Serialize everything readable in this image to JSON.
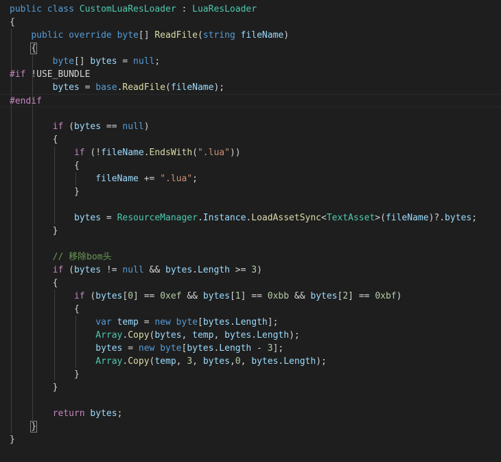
{
  "editor": {
    "language": "csharp",
    "colors": {
      "background": "#1e1e1e",
      "keyword": "#569cd6",
      "control": "#c586c0",
      "type": "#4ec9b0",
      "function": "#dcdcaa",
      "identifier": "#9cdcfe",
      "string": "#ce9178",
      "number": "#b5cea8",
      "comment": "#6a9955",
      "text": "#d4d4d4"
    },
    "lines": [
      {
        "indent": 0,
        "tokens": [
          [
            "kw",
            "public"
          ],
          [
            "punct",
            " "
          ],
          [
            "kw",
            "class"
          ],
          [
            "punct",
            " "
          ],
          [
            "type",
            "CustomLuaResLoader"
          ],
          [
            "punct",
            " : "
          ],
          [
            "type",
            "LuaResLoader"
          ]
        ]
      },
      {
        "indent": 0,
        "tokens": [
          [
            "punct",
            "{"
          ]
        ]
      },
      {
        "indent": 1,
        "tokens": [
          [
            "kw",
            "public"
          ],
          [
            "punct",
            " "
          ],
          [
            "kw",
            "override"
          ],
          [
            "punct",
            " "
          ],
          [
            "kw",
            "byte"
          ],
          [
            "punct",
            "[] "
          ],
          [
            "fn",
            "ReadFile"
          ],
          [
            "punct",
            "("
          ],
          [
            "kw",
            "string"
          ],
          [
            "punct",
            " "
          ],
          [
            "id",
            "fileName"
          ],
          [
            "punct",
            ")"
          ]
        ]
      },
      {
        "indent": 1,
        "tokens": [
          [
            "bracket",
            "{"
          ]
        ]
      },
      {
        "indent": 2,
        "tokens": [
          [
            "kw",
            "byte"
          ],
          [
            "punct",
            "[] "
          ],
          [
            "id",
            "bytes"
          ],
          [
            "punct",
            " = "
          ],
          [
            "kw",
            "null"
          ],
          [
            "punct",
            ";"
          ]
        ]
      },
      {
        "indent": 0,
        "tokens": [
          [
            "pre",
            "#if"
          ],
          [
            "pre-name",
            " !USE_BUNDLE"
          ]
        ]
      },
      {
        "indent": 2,
        "tokens": [
          [
            "id",
            "bytes"
          ],
          [
            "punct",
            " = "
          ],
          [
            "kw",
            "base"
          ],
          [
            "punct",
            "."
          ],
          [
            "fn",
            "ReadFile"
          ],
          [
            "punct",
            "("
          ],
          [
            "id",
            "fileName"
          ],
          [
            "punct",
            ");"
          ]
        ]
      },
      {
        "indent": 0,
        "current": true,
        "tokens": [
          [
            "pre",
            "#endif"
          ]
        ]
      },
      {
        "indent": 0,
        "tokens": []
      },
      {
        "indent": 2,
        "tokens": [
          [
            "ctl",
            "if"
          ],
          [
            "punct",
            " ("
          ],
          [
            "id",
            "bytes"
          ],
          [
            "punct",
            " == "
          ],
          [
            "kw",
            "null"
          ],
          [
            "punct",
            ")"
          ]
        ]
      },
      {
        "indent": 2,
        "tokens": [
          [
            "punct",
            "{"
          ]
        ]
      },
      {
        "indent": 3,
        "tokens": [
          [
            "ctl",
            "if"
          ],
          [
            "punct",
            " (!"
          ],
          [
            "id",
            "fileName"
          ],
          [
            "punct",
            "."
          ],
          [
            "fn",
            "EndsWith"
          ],
          [
            "punct",
            "("
          ],
          [
            "str",
            "\".lua\""
          ],
          [
            "punct",
            "))"
          ]
        ]
      },
      {
        "indent": 3,
        "tokens": [
          [
            "punct",
            "{"
          ]
        ]
      },
      {
        "indent": 4,
        "tokens": [
          [
            "id",
            "fileName"
          ],
          [
            "punct",
            " += "
          ],
          [
            "str",
            "\".lua\""
          ],
          [
            "punct",
            ";"
          ]
        ]
      },
      {
        "indent": 3,
        "tokens": [
          [
            "punct",
            "}"
          ]
        ]
      },
      {
        "indent": 0,
        "tokens": []
      },
      {
        "indent": 3,
        "tokens": [
          [
            "id",
            "bytes"
          ],
          [
            "punct",
            " = "
          ],
          [
            "type",
            "ResourceManager"
          ],
          [
            "punct",
            "."
          ],
          [
            "id",
            "Instance"
          ],
          [
            "punct",
            "."
          ],
          [
            "fn",
            "LoadAssetSync"
          ],
          [
            "punct",
            "<"
          ],
          [
            "type",
            "TextAsset"
          ],
          [
            "punct",
            ">("
          ],
          [
            "id",
            "fileName"
          ],
          [
            "punct",
            ")?."
          ],
          [
            "id",
            "bytes"
          ],
          [
            "punct",
            ";"
          ]
        ]
      },
      {
        "indent": 2,
        "tokens": [
          [
            "punct",
            "}"
          ]
        ]
      },
      {
        "indent": 0,
        "tokens": []
      },
      {
        "indent": 2,
        "tokens": [
          [
            "cmt",
            "// 移除bom头"
          ]
        ]
      },
      {
        "indent": 2,
        "tokens": [
          [
            "ctl",
            "if"
          ],
          [
            "punct",
            " ("
          ],
          [
            "id",
            "bytes"
          ],
          [
            "punct",
            " != "
          ],
          [
            "kw",
            "null"
          ],
          [
            "punct",
            " && "
          ],
          [
            "id",
            "bytes"
          ],
          [
            "punct",
            "."
          ],
          [
            "id",
            "Length"
          ],
          [
            "punct",
            " >= "
          ],
          [
            "num",
            "3"
          ],
          [
            "punct",
            ")"
          ]
        ]
      },
      {
        "indent": 2,
        "tokens": [
          [
            "punct",
            "{"
          ]
        ]
      },
      {
        "indent": 3,
        "tokens": [
          [
            "ctl",
            "if"
          ],
          [
            "punct",
            " ("
          ],
          [
            "id",
            "bytes"
          ],
          [
            "punct",
            "["
          ],
          [
            "num",
            "0"
          ],
          [
            "punct",
            "] == "
          ],
          [
            "num",
            "0xef"
          ],
          [
            "punct",
            " && "
          ],
          [
            "id",
            "bytes"
          ],
          [
            "punct",
            "["
          ],
          [
            "num",
            "1"
          ],
          [
            "punct",
            "] == "
          ],
          [
            "num",
            "0xbb"
          ],
          [
            "punct",
            " && "
          ],
          [
            "id",
            "bytes"
          ],
          [
            "punct",
            "["
          ],
          [
            "num",
            "2"
          ],
          [
            "punct",
            "] == "
          ],
          [
            "num",
            "0xbf"
          ],
          [
            "punct",
            ")"
          ]
        ]
      },
      {
        "indent": 3,
        "tokens": [
          [
            "punct",
            "{"
          ]
        ]
      },
      {
        "indent": 4,
        "tokens": [
          [
            "kw",
            "var"
          ],
          [
            "punct",
            " "
          ],
          [
            "id",
            "temp"
          ],
          [
            "punct",
            " = "
          ],
          [
            "kw",
            "new"
          ],
          [
            "punct",
            " "
          ],
          [
            "kw",
            "byte"
          ],
          [
            "punct",
            "["
          ],
          [
            "id",
            "bytes"
          ],
          [
            "punct",
            "."
          ],
          [
            "id",
            "Length"
          ],
          [
            "punct",
            "];"
          ]
        ]
      },
      {
        "indent": 4,
        "tokens": [
          [
            "type",
            "Array"
          ],
          [
            "punct",
            "."
          ],
          [
            "fn",
            "Copy"
          ],
          [
            "punct",
            "("
          ],
          [
            "id",
            "bytes"
          ],
          [
            "punct",
            ", "
          ],
          [
            "id",
            "temp"
          ],
          [
            "punct",
            ", "
          ],
          [
            "id",
            "bytes"
          ],
          [
            "punct",
            "."
          ],
          [
            "id",
            "Length"
          ],
          [
            "punct",
            ");"
          ]
        ]
      },
      {
        "indent": 4,
        "tokens": [
          [
            "id",
            "bytes"
          ],
          [
            "punct",
            " = "
          ],
          [
            "kw",
            "new"
          ],
          [
            "punct",
            " "
          ],
          [
            "kw",
            "byte"
          ],
          [
            "punct",
            "["
          ],
          [
            "id",
            "bytes"
          ],
          [
            "punct",
            "."
          ],
          [
            "id",
            "Length"
          ],
          [
            "punct",
            " - "
          ],
          [
            "num",
            "3"
          ],
          [
            "punct",
            "];"
          ]
        ]
      },
      {
        "indent": 4,
        "tokens": [
          [
            "type",
            "Array"
          ],
          [
            "punct",
            "."
          ],
          [
            "fn",
            "Copy"
          ],
          [
            "punct",
            "("
          ],
          [
            "id",
            "temp"
          ],
          [
            "punct",
            ", "
          ],
          [
            "num",
            "3"
          ],
          [
            "punct",
            ", "
          ],
          [
            "id",
            "bytes"
          ],
          [
            "punct",
            ","
          ],
          [
            "num",
            "0"
          ],
          [
            "punct",
            ", "
          ],
          [
            "id",
            "bytes"
          ],
          [
            "punct",
            "."
          ],
          [
            "id",
            "Length"
          ],
          [
            "punct",
            ");"
          ]
        ]
      },
      {
        "indent": 3,
        "tokens": [
          [
            "punct",
            "}"
          ]
        ]
      },
      {
        "indent": 2,
        "tokens": [
          [
            "punct",
            "}"
          ]
        ]
      },
      {
        "indent": 0,
        "tokens": []
      },
      {
        "indent": 2,
        "tokens": [
          [
            "ctl",
            "return"
          ],
          [
            "punct",
            " "
          ],
          [
            "id",
            "bytes"
          ],
          [
            "punct",
            ";"
          ]
        ]
      },
      {
        "indent": 1,
        "tokens": [
          [
            "bracket",
            "}"
          ]
        ]
      },
      {
        "indent": 0,
        "tokens": [
          [
            "punct",
            "}"
          ]
        ]
      }
    ]
  }
}
